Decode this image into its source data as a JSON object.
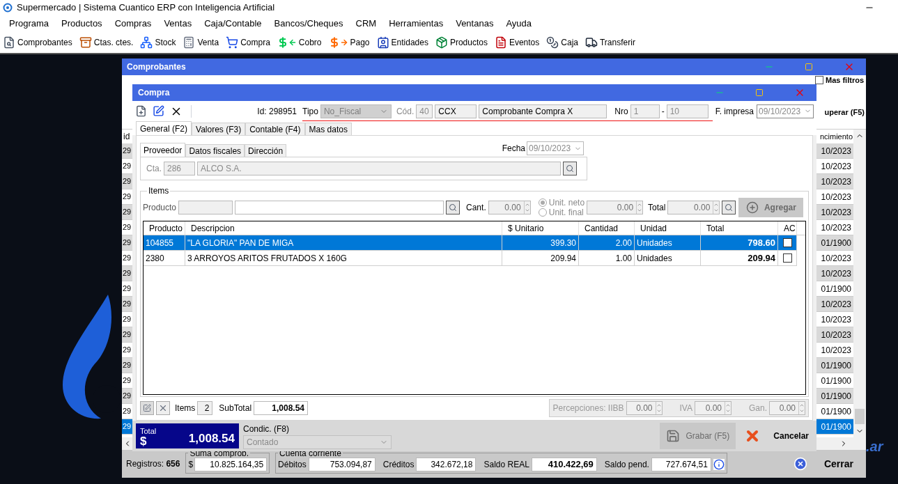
{
  "app": {
    "title": "Supermercado | Sistema Cuantico ERP con Inteligencia Artificial"
  },
  "menu": [
    "Programa",
    "Productos",
    "Compras",
    "Ventas",
    "Caja/Contable",
    "Bancos/Cheques",
    "CRM",
    "Herramientas",
    "Ventanas",
    "Ayuda"
  ],
  "toolbar": [
    "Comprobantes",
    "Ctas. ctes.",
    "Stock",
    "Venta",
    "Compra",
    "Cobro",
    "Pago",
    "Entidades",
    "Productos",
    "Eventos",
    "Caja",
    "Transferir"
  ],
  "desktop": {
    "logo_text": ".ar"
  },
  "comprobantes": {
    "title": "Comprobantes",
    "filters_checkbox": {
      "label": "Mas filtros",
      "checked": false
    },
    "recover_button": "uperar (F5)",
    "columns": [
      "id",
      "ncimiento"
    ],
    "rows": [
      {
        "column_1": "29",
        "column_2": "10/2023",
        "selected": false
      },
      {
        "column_1": "29",
        "column_2": "10/2023",
        "selected": false
      },
      {
        "column_1": "29",
        "column_2": "10/2023",
        "selected": false
      },
      {
        "column_1": "29",
        "column_2": "10/2023",
        "selected": false
      },
      {
        "column_1": "29",
        "column_2": "10/2023",
        "selected": false
      },
      {
        "column_1": "29",
        "column_2": "10/2023",
        "selected": false
      },
      {
        "column_1": "29",
        "column_2": "01/1900",
        "selected": false
      },
      {
        "column_1": "29",
        "column_2": "10/2023",
        "selected": false
      },
      {
        "column_1": "29",
        "column_2": "10/2023",
        "selected": false
      },
      {
        "column_1": "29",
        "column_2": "01/1900",
        "selected": false
      },
      {
        "column_1": "29",
        "column_2": "10/2023",
        "selected": false
      },
      {
        "column_1": "29",
        "column_2": "10/2023",
        "selected": false
      },
      {
        "column_1": "29",
        "column_2": "10/2023",
        "selected": false
      },
      {
        "column_1": "29",
        "column_2": "10/2023",
        "selected": false
      },
      {
        "column_1": "29",
        "column_2": "01/1900",
        "selected": false
      },
      {
        "column_1": "29",
        "column_2": "01/1900",
        "selected": false
      },
      {
        "column_1": "29",
        "column_2": "01/1900",
        "selected": false
      },
      {
        "column_1": "29",
        "column_2": "01/1900",
        "selected": false
      },
      {
        "column_1": "29",
        "column_2": "01/1900",
        "selected": true
      }
    ],
    "footer": {
      "records_label": "Registros:",
      "records": "656",
      "sum_title": "Suma comprob.",
      "sum_currency": "$",
      "sum": "10.825.164,35",
      "account_title": "Cuenta corriente",
      "debits_label": "Débitos",
      "debits": "753.094,87",
      "credits_label": "Créditos",
      "credits": "342.672,18",
      "real_balance_label": "Saldo REAL",
      "real_balance": "410.422,69",
      "pending_label": "Saldo pend.",
      "pending": "727.674,51",
      "close_button": "Cerrar"
    }
  },
  "compra": {
    "title": "Compra",
    "id_label": "Id:",
    "id": "298951",
    "type_label": "Tipo",
    "type": "No_Fiscal",
    "code_label": "Cód.",
    "code": "40",
    "voucher_code": "CCX",
    "voucher_name": "Comprobante Compra X",
    "number_label": "Nro",
    "number_prefix": "1",
    "number_separator": "-",
    "number": "10",
    "print_date_label": "F. impresa",
    "print_date": "09/10/2023",
    "tabs": [
      {
        "label": "General (F2)",
        "selected": true
      },
      {
        "label": "Valores (F3)",
        "selected": false
      },
      {
        "label": "Contable (F4)",
        "selected": false
      },
      {
        "label": "Mas datos",
        "selected": false
      }
    ],
    "sub_tabs": [
      {
        "label": "Proveedor",
        "selected": true
      },
      {
        "label": "Datos fiscales",
        "selected": false
      },
      {
        "label": "Dirección",
        "selected": false
      }
    ],
    "date_label": "Fecha",
    "date": "09/10/2023",
    "account_label": "Cta.",
    "account": "286",
    "supplier": "ALCO S.A.",
    "items": {
      "title": "Items",
      "product_label": "Producto",
      "quantity_label": "Cant.",
      "quantity": "0.00",
      "price_modes": [
        {
          "label": "Unit. neto",
          "selected": true
        },
        {
          "label": "Unit. final",
          "selected": false
        }
      ],
      "price": "0.00",
      "total_label": "Total",
      "total": "0.00",
      "add_button": {
        "label": "Agregar",
        "disabled": true
      },
      "columns": [
        "Producto",
        "Descripcion",
        "$ Unitario",
        "Cantidad",
        "Unidad",
        "Total",
        "AC"
      ],
      "rows": [
        {
          "product": "104855",
          "description": "\"LA GLORIA\" PAN DE MIGA",
          "unit_price": "399.30",
          "quantity": "2.00",
          "unit": "Unidades",
          "total": "798.60",
          "ac": false,
          "selected": true
        },
        {
          "product": "2380",
          "description": "3 ARROYOS ARITOS FRUTADOS X 160G",
          "unit_price": "209.94",
          "quantity": "1.00",
          "unit": "Unidades",
          "total": "209.94",
          "ac": false,
          "selected": false
        }
      ]
    },
    "summary": {
      "items_label": "Items",
      "items": "2",
      "subtotal_label": "SubTotal",
      "subtotal": "1,008.54",
      "iibb_label": "Percepciones: IIBB",
      "iibb": "0.00",
      "iva_label": "IVA",
      "iva": "0.00",
      "gan_label": "Gan.",
      "gan": "0.00"
    },
    "total_label": "Total",
    "total_currency": "$",
    "total": "1,008.54",
    "condition_label": "Condic. (F8)",
    "condition": "Contado",
    "condition_disabled": true,
    "save_button": {
      "label": "Grabar (F5)",
      "disabled": true
    },
    "cancel_button": "Cancelar"
  }
}
